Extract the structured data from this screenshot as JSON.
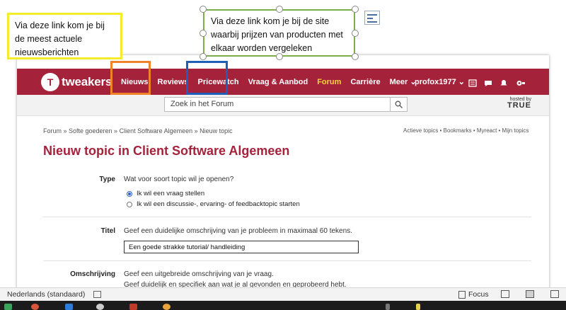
{
  "callouts": {
    "news": "Via deze link kom je bij de meest actuele nieuwsberichten",
    "pricewatch": "Via deze link kom je bij de site waarbij prijzen van producten met elkaar worden vergeleken"
  },
  "site": {
    "logo_text": "tweakers",
    "nav": [
      "Nieuws",
      "Reviews",
      "Pricewatch",
      "Vraag & Aanbod",
      "Forum",
      "Carrière",
      "Meer ⌄"
    ],
    "user": "profox1977 ⌄",
    "search_placeholder": "Zoek in het Forum",
    "hosted_by": "hosted by",
    "host_name": "TRUE",
    "breadcrumb": "Forum » Softe goederen » Client Software Algemeen » Nieuw topic",
    "quicklinks": "Actieve topics • Bookmarks • Myreact • Mijn topics",
    "page_title": "Nieuw topic in Client Software Algemeen"
  },
  "form": {
    "type_label": "Type",
    "type_question": "Wat voor soort topic wil je openen?",
    "options": [
      "Ik wil een vraag stellen",
      "Ik wil een discussie-, ervaring- of feedbacktopic starten"
    ],
    "selected_option": 0,
    "title_label": "Titel",
    "title_hint": "Geef een duidelijke omschrijving van je probleem in maximaal 60 tekens.",
    "title_value": "Een goede strakke tutorial/ handleiding",
    "desc_label": "Omschrijving",
    "desc_line1": "Geef een uitgebreide omschrijving van je vraag.",
    "desc_line2": "Geef duidelijk en specifiek aan wat je al gevonden en geprobeerd hebt."
  },
  "statusbar": {
    "language": "Nederlands (standaard)",
    "focus": "Focus"
  },
  "colors": {
    "brand": "#a5223b",
    "forum_highlight": "#f5d33a",
    "callout_yellow": "#f5ec2a",
    "callout_green": "#7cae4c",
    "frame_orange": "#f0822b",
    "frame_blue": "#1f5fb8"
  }
}
